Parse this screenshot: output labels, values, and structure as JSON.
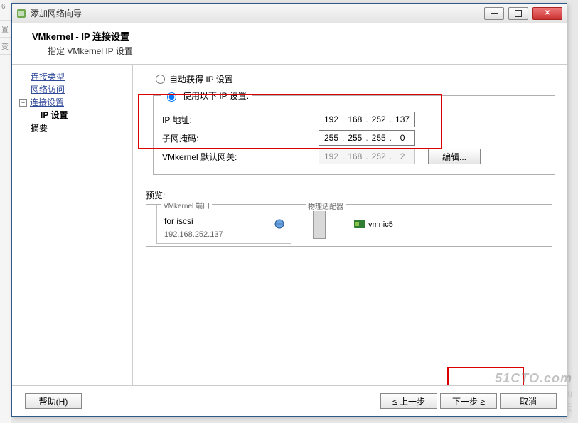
{
  "window": {
    "title": "添加网络向导",
    "minimize_tip": "minimize",
    "maximize_tip": "maximize",
    "close_tip": "close"
  },
  "header": {
    "title": "VMkernel - IP 连接设置",
    "subtitle": "指定 VMkernel IP 设置"
  },
  "nav": {
    "item_type": "连接类型",
    "item_access": "网络访问",
    "item_conn_settings": "连接设置",
    "item_ip_settings": "IP 设置",
    "item_summary": "摘要",
    "expander": "−"
  },
  "form": {
    "radio_auto": "自动获得 IP 设置",
    "radio_manual": "使用以下 IP 设置:",
    "label_ip": "IP 地址:",
    "label_mask": "子网掩码:",
    "label_gateway": "VMkernel 默认网关:",
    "ip": {
      "o1": "192",
      "o2": "168",
      "o3": "252",
      "o4": "137"
    },
    "mask": {
      "o1": "255",
      "o2": "255",
      "o3": "255",
      "o4": "0"
    },
    "gateway": {
      "o1": "192",
      "o2": "168",
      "o3": "252",
      "o4": "2"
    },
    "edit_button": "编辑..."
  },
  "preview": {
    "label": "预览:",
    "vm_group_title": "VMkernel 端口",
    "port_name": "for iscsi",
    "port_ip": "192.168.252.137",
    "phys_adapter_title": "物理适配器",
    "vmnic": "vmnic5"
  },
  "footer": {
    "help": "帮助(H)",
    "back": "≤ 上一步",
    "next": "下一步 ≥",
    "cancel": "取消"
  },
  "watermarks": {
    "w1": "51CTO.com",
    "w2": "技术·博客·Blog",
    "w3": "ⓞ 亿速云"
  }
}
